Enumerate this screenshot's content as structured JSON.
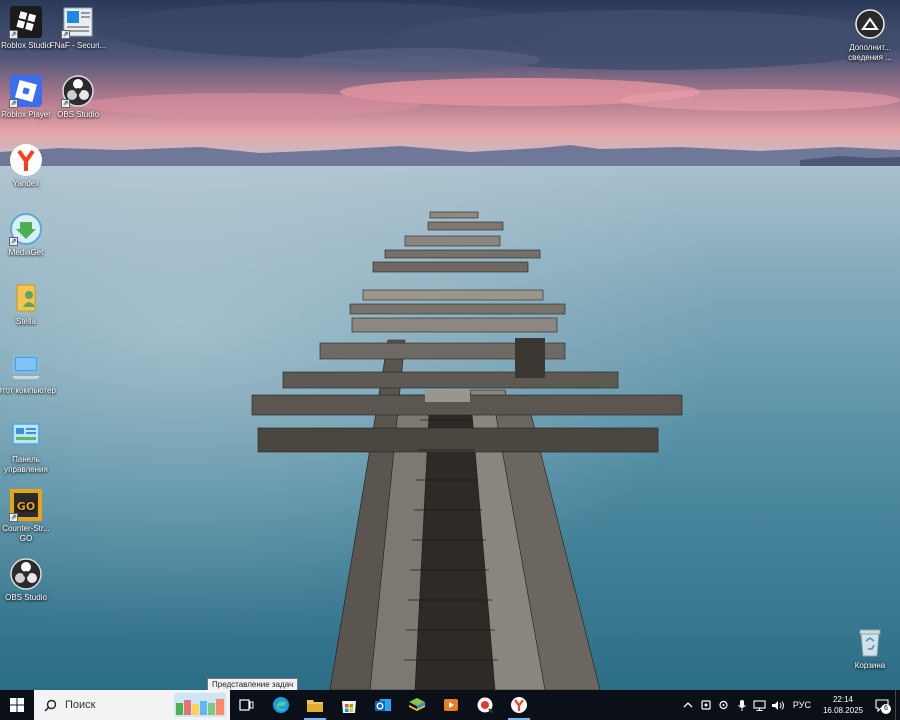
{
  "desktop": {
    "icons_left": [
      {
        "label": "Roblox Studio",
        "icon": "roblox-studio-icon"
      },
      {
        "label": "FNaF - Securi...",
        "icon": "fnaf-icon"
      },
      {
        "label": "Roblox Player",
        "icon": "roblox-player-icon"
      },
      {
        "label": "OBS Studio",
        "icon": "obs-icon"
      },
      {
        "label": "Yandex",
        "icon": "yandex-icon"
      },
      {
        "label": "MediaGet",
        "icon": "mediaget-icon"
      },
      {
        "label": "Stella",
        "icon": "folder-user-icon"
      },
      {
        "label": "Этот компьютер",
        "icon": "this-pc-icon"
      },
      {
        "label": "Панель управления",
        "icon": "control-panel-icon"
      },
      {
        "label": "Counter-Str... GO",
        "icon": "csgo-icon"
      },
      {
        "label": "OBS Studio",
        "icon": "obs-icon"
      }
    ],
    "top_right_icon": {
      "label": "Дополнит... сведения ...",
      "icon": "info-shortcut-icon"
    },
    "recycle_bin": {
      "label": "Корзина",
      "icon": "recycle-bin-icon"
    }
  },
  "taskbar": {
    "search_placeholder": "Поиск",
    "tooltip": "Представление задач",
    "pinned_apps": [
      "task-view-icon",
      "edge-icon",
      "file-explorer-icon",
      "microsoft-store-icon",
      "outlook-icon",
      "bluestacks-icon",
      "media-player-icon",
      "recorder-icon",
      "yandex-browser-icon"
    ],
    "tray": {
      "language": "РУС",
      "time": "22:14",
      "date": "16.08.2025",
      "notification_count": "6"
    }
  },
  "colors": {
    "taskbar_bg": "#0a0f18",
    "accent": "#7ab7f0"
  }
}
